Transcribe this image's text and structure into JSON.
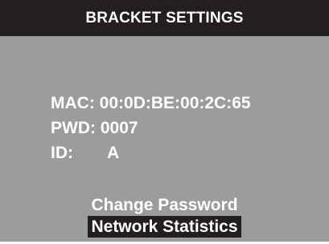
{
  "header": {
    "title": "BRACKET SETTINGS"
  },
  "info": {
    "mac_label": "MAC:",
    "mac_value": "00:0D:BE:00:2C:65",
    "pwd_label": "PWD:",
    "pwd_value": "0007",
    "id_label": "ID:",
    "id_value": "A"
  },
  "menu": {
    "items": [
      {
        "label": "Change Password",
        "selected": false
      },
      {
        "label": "Network Statistics",
        "selected": true
      }
    ]
  },
  "colors": {
    "background": "#9c9c9c",
    "title_bar": "#231f20",
    "text": "#ffffff",
    "selection_highlight": "#231f20"
  }
}
